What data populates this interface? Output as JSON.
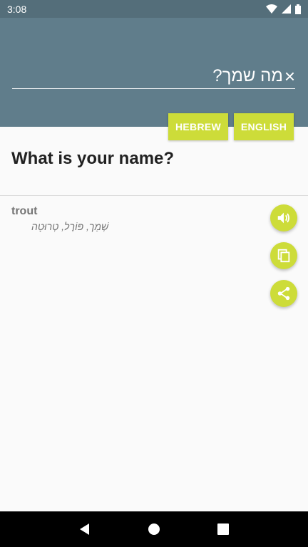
{
  "status_bar": {
    "time": "3:08"
  },
  "input": {
    "text": "מה שמך?",
    "clear_symbol": "×"
  },
  "language_buttons": {
    "source": "HEBREW",
    "target": "ENGLISH"
  },
  "translation": {
    "text": "What is your name?"
  },
  "dictionary": {
    "word": "trout",
    "synonyms": "שְׁמַך, פּוֹרֶל, טְרוּטָה"
  },
  "icons": {
    "speak": "volume-icon",
    "copy": "copy-icon",
    "share": "share-icon",
    "wifi": "wifi-icon",
    "signal": "signal-icon",
    "battery": "battery-icon",
    "back": "back-icon",
    "home": "home-icon",
    "recents": "recents-icon"
  },
  "colors": {
    "header": "#607d8b",
    "status_bar": "#546e7a",
    "accent": "#cddc39"
  }
}
